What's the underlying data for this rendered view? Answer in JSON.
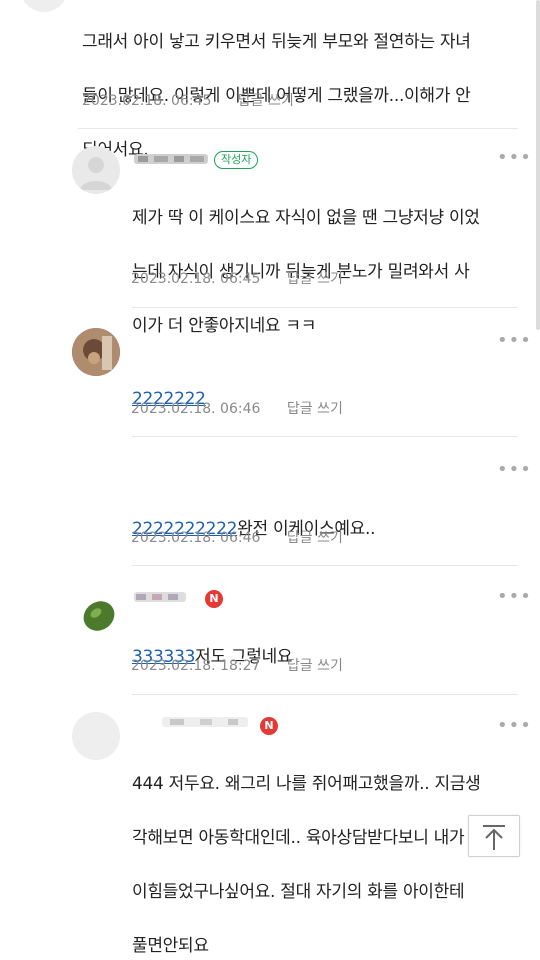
{
  "comments": [
    {
      "text": "그래서 아이 낳고 키우면서 뒤늦게 부모와 절연하는 자녀들이 많데요. 이렇게 이쁜데 어떻게 그랬을까...이해가 안되어서요.",
      "line1": "그래서 아이 낳고 키우면서 뒤늦게 부모와 절연하는 자녀",
      "line2": "들이 많데요. 이렇게 이쁜데 어떻게 그랬을까...이해가 안",
      "line3": "되어서요.",
      "date": "2023.02.18. 06:45",
      "reply_label": "답글 쓰기"
    },
    {
      "badge": "작성자",
      "line1": "제가 딱 이 케이스요 자식이 없을 땐 그냥저냥 이었",
      "line2": "는데 자식이 생기니까 뒤늦게 분노가 밀려와서 사",
      "line3": "이가 더 안좋아지네요 ㅋㅋ",
      "date": "2023.02.18. 06:45",
      "reply_label": "답글 쓰기",
      "more": "•••"
    },
    {
      "link": "2222222",
      "date": "2023.02.18. 06:46",
      "reply_label": "답글 쓰기",
      "more": "•••"
    },
    {
      "link": "2222222222",
      "text": "완전 이케이스예요..",
      "date": "2023.02.18. 06:46",
      "reply_label": "답글 쓰기",
      "more": "•••"
    },
    {
      "badge": "N",
      "link": "333333",
      "text": "저도 그렇네요",
      "date": "2023.02.18. 18:27",
      "reply_label": "답글 쓰기",
      "more": "•••"
    },
    {
      "badge": "N",
      "line1": "444 저두요. 왜그리 나를 쥐어패고했을까.. 지금생",
      "line2": "각해보면 아동학대인데.. 육아상담받다보니 내가 많",
      "line3": "이힘들었구나싶어요. 절대 자기의 화를 아이한테",
      "line4": "풀면안되요",
      "more": "•••"
    }
  ],
  "colors": {
    "link": "#1a5fb4",
    "author_badge": "#1ea35a",
    "new_badge": "#e53935",
    "meta": "#8a8a8a"
  },
  "icons": {
    "more": "more-horizontal-icon",
    "scroll_top": "arrow-up-to-top-icon"
  }
}
